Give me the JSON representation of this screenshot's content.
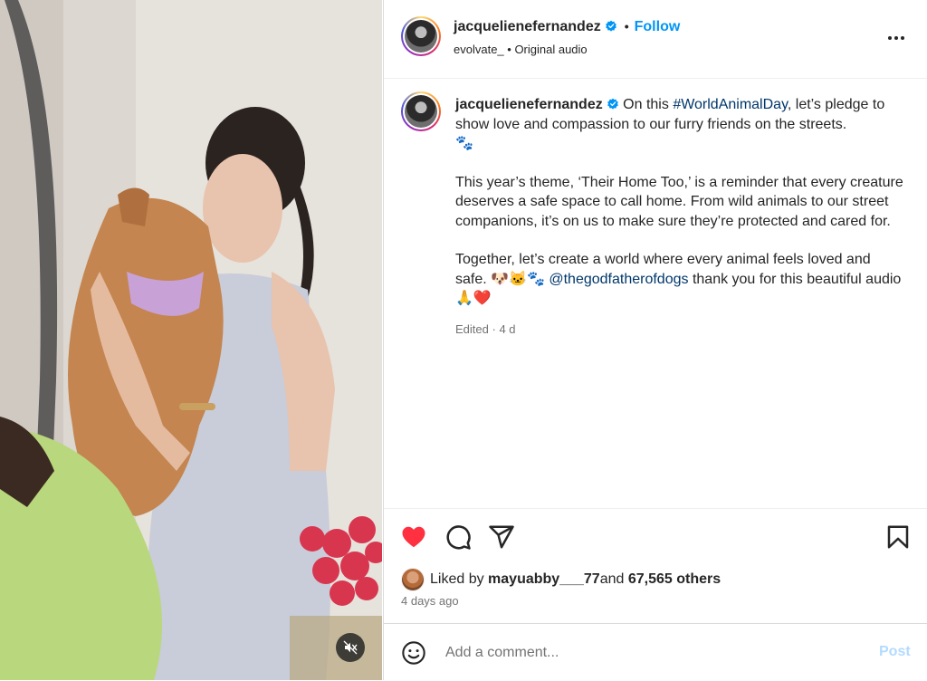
{
  "post": {
    "username": "jacquelienefernandez",
    "follow_label": "Follow",
    "dot": "•",
    "audio_owner": "evolvate_",
    "audio_sep": " • ",
    "audio_label": "Original audio",
    "verified": true
  },
  "caption": {
    "line1_pre": "On this ",
    "hashtag": "#WorldAnimalDay",
    "line1_post": ", let’s pledge to show love and compassion to our furry friends on the streets.",
    "emoji_paws": "🐾",
    "para2": "This year’s theme, ‘Their Home Too,’ is a reminder that every creature deserves a safe space to call home. From wild animals to our street companions, it’s on us to make sure they’re protected and cared for.",
    "para3_pre": "Together, let’s create a world where every animal feels loved and safe. ",
    "para3_emoji": "🐶🐱🐾 ",
    "mention": "@thegodfatherofdogs",
    "para3_post": " thank you for this beautiful audio ",
    "para3_end_emoji": "🙏❤️",
    "edited": "Edited",
    "edited_sep": " · ",
    "age": "4 d"
  },
  "likes": {
    "prefix": "Liked by ",
    "liker": "mayuabby___77",
    "and": " and ",
    "count": "67,565 others"
  },
  "timestamp": "4 days ago",
  "comment": {
    "placeholder": "Add a comment...",
    "post_label": "Post"
  },
  "colors": {
    "like_red": "#ff3040",
    "link_blue": "#0095f6",
    "post_disabled": "#b3dbff"
  },
  "icons": {
    "like": "heart-filled-icon",
    "comment": "comment-icon",
    "share": "share-icon",
    "save": "bookmark-icon",
    "more": "more-options-icon",
    "mute": "audio-muted-icon",
    "emoji": "emoji-icon"
  }
}
